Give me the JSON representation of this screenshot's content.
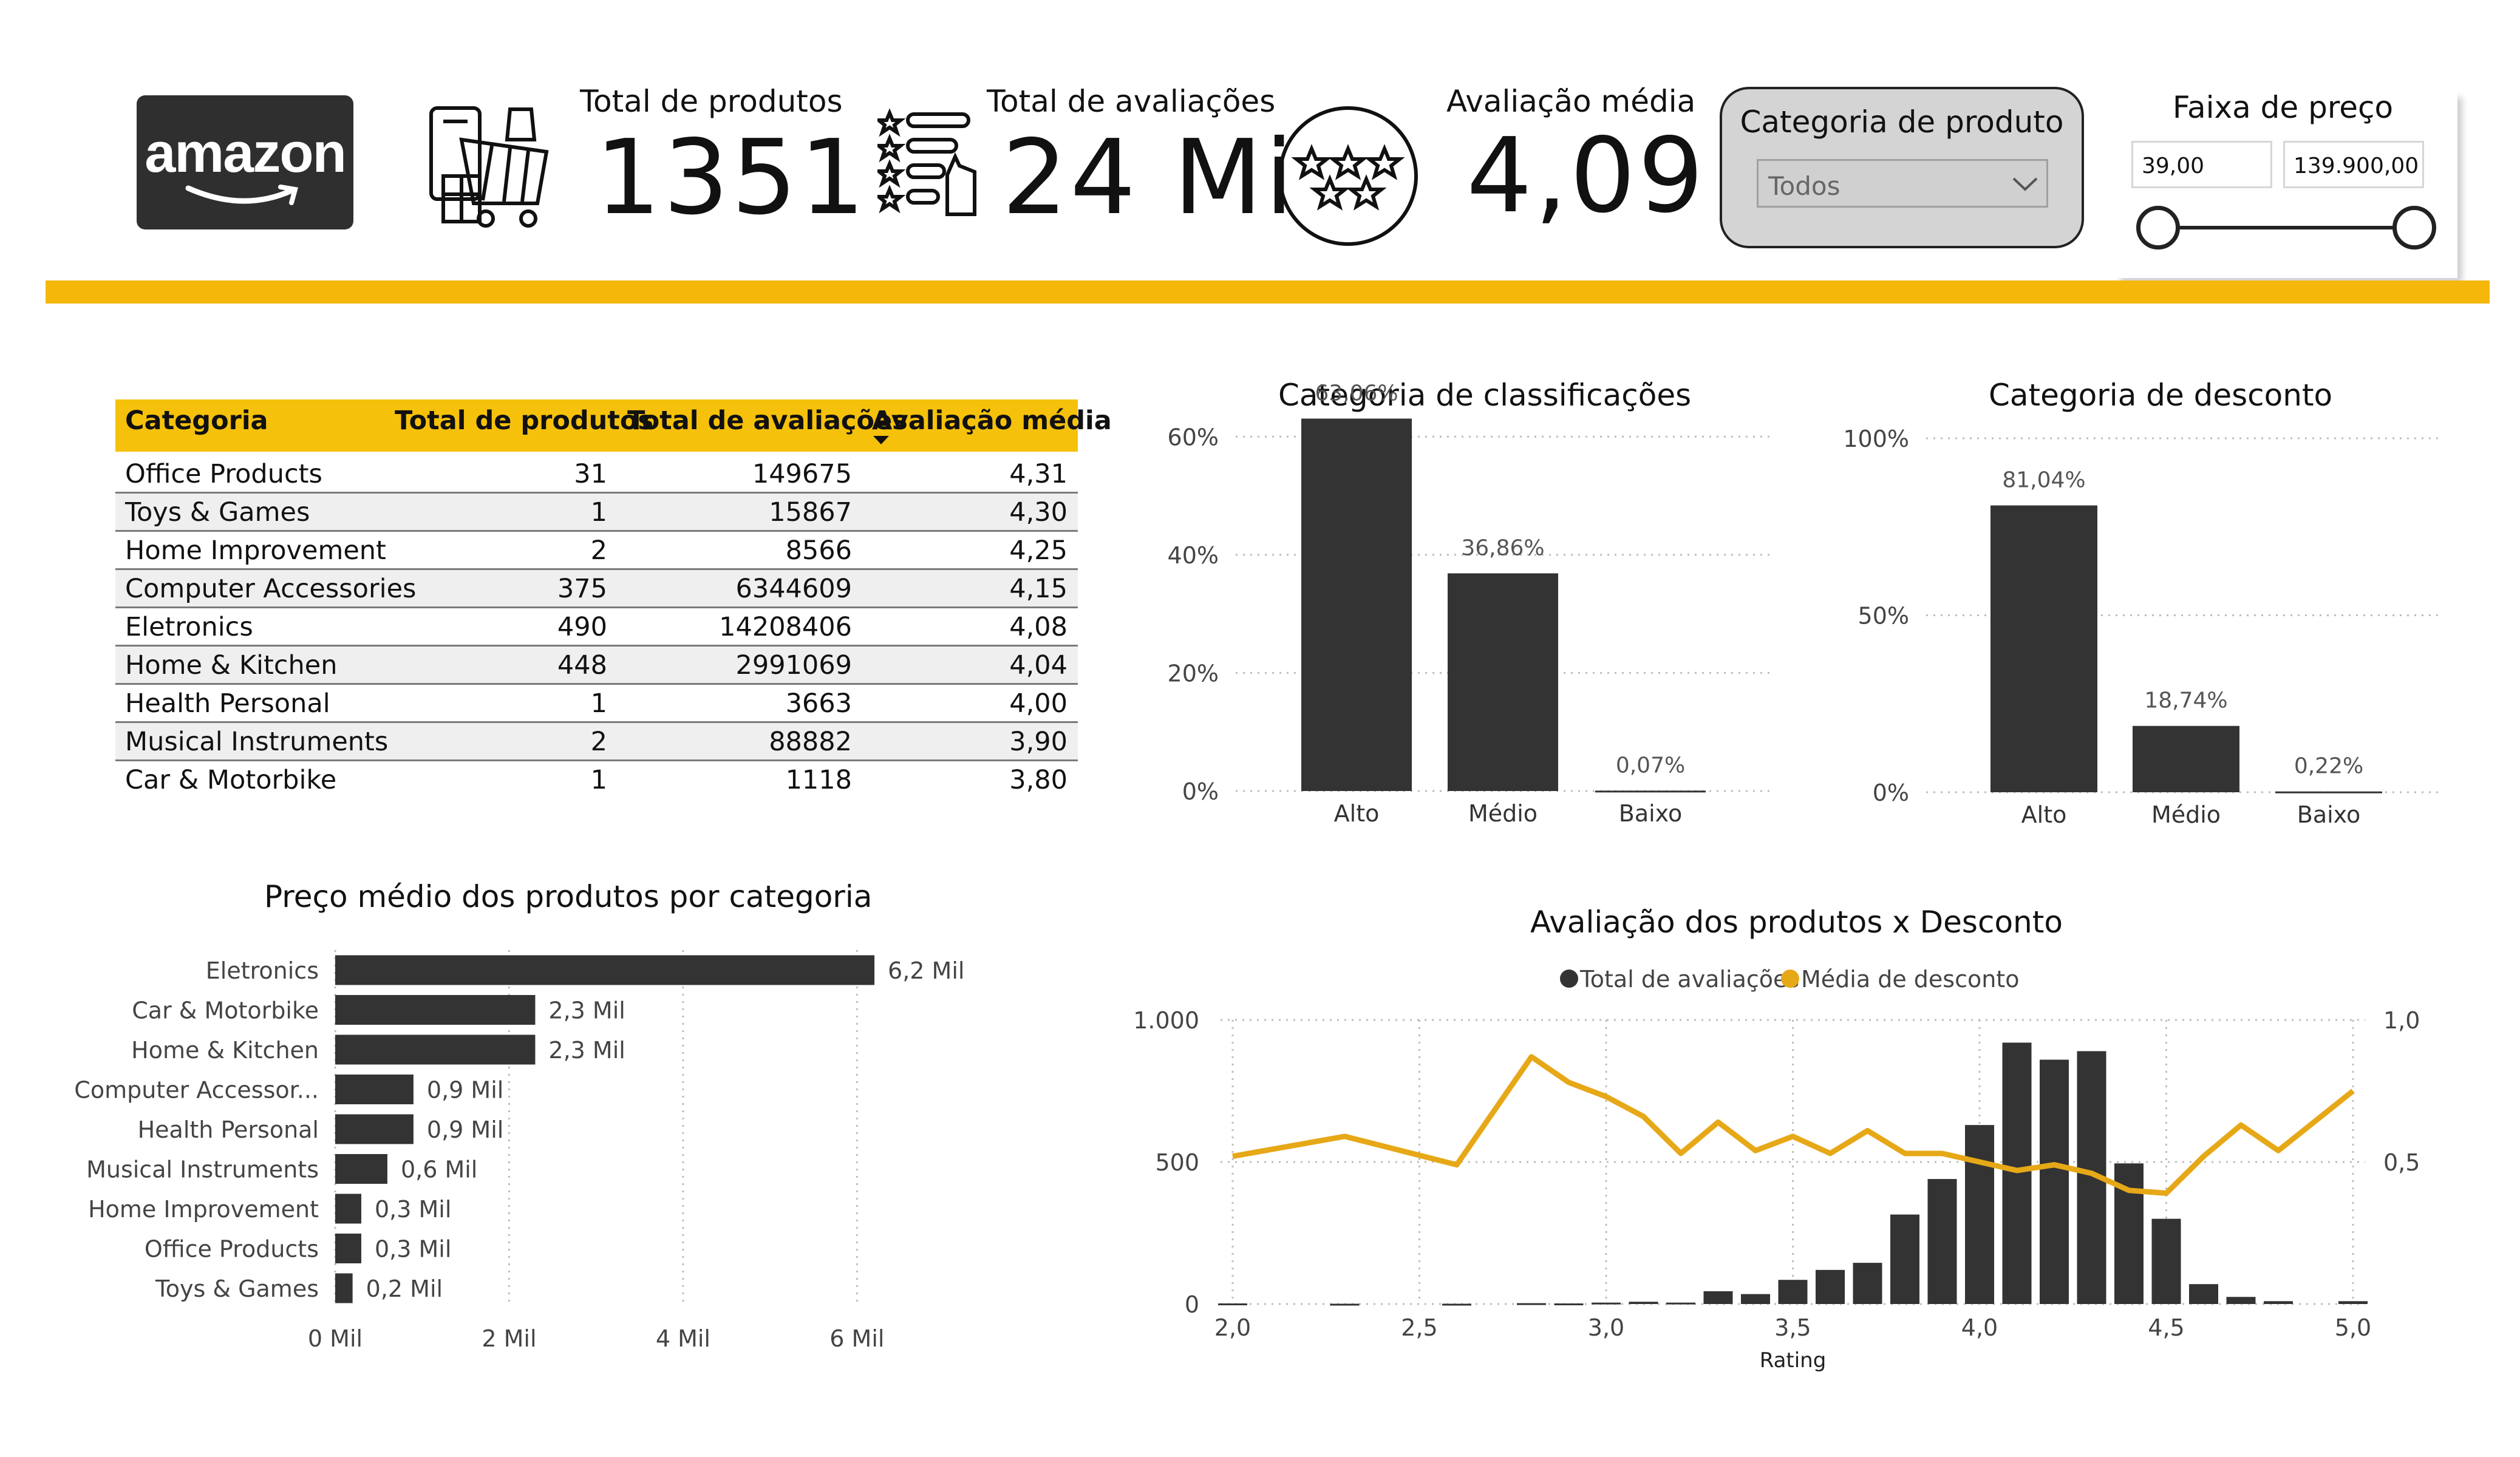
{
  "header": {
    "logo_text": "amazon",
    "kpis": [
      {
        "label": "Total de produtos",
        "value": "1351"
      },
      {
        "label": "Total de avaliações",
        "value": "24 Mi"
      },
      {
        "label": "Avaliação média",
        "value": "4,09"
      }
    ],
    "category_filter": {
      "title": "Categoria de produto",
      "selected": "Todos"
    },
    "price_filter": {
      "title": "Faixa de preço",
      "min": "39,00",
      "max": "139.900,00"
    }
  },
  "colors": {
    "accent": "#f5b70a",
    "bar": "#333333",
    "line": "#e6a817"
  },
  "table": {
    "columns": [
      "Categoria",
      "Total de produtos",
      "Total de avaliações",
      "Avaliação média"
    ],
    "sort_column": "Avaliação média",
    "rows": [
      [
        "Office Products",
        "31",
        "149675",
        "4,31"
      ],
      [
        "Toys & Games",
        "1",
        "15867",
        "4,30"
      ],
      [
        "Home Improvement",
        "2",
        "8566",
        "4,25"
      ],
      [
        "Computer Accessories",
        "375",
        "6344609",
        "4,15"
      ],
      [
        "Eletronics",
        "490",
        "14208406",
        "4,08"
      ],
      [
        "Home & Kitchen",
        "448",
        "2991069",
        "4,04"
      ],
      [
        "Health Personal",
        "1",
        "3663",
        "4,00"
      ],
      [
        "Musical Instruments",
        "2",
        "88882",
        "3,90"
      ],
      [
        "Car & Motorbike",
        "1",
        "1118",
        "3,80"
      ]
    ]
  },
  "chart_data": [
    {
      "type": "bar",
      "title": "Categoria de classificações",
      "categories": [
        "Alto",
        "Médio",
        "Baixo"
      ],
      "values": [
        63.06,
        36.86,
        0.07
      ],
      "data_labels": [
        "63,06%",
        "36,86%",
        "0,07%"
      ],
      "ylim": [
        0,
        70
      ],
      "yticks": [
        0,
        20,
        40,
        60
      ],
      "ytick_labels": [
        "0%",
        "20%",
        "40%",
        "60%"
      ],
      "grid": true
    },
    {
      "type": "bar",
      "title": "Categoria de desconto",
      "categories": [
        "Alto",
        "Médio",
        "Baixo"
      ],
      "values": [
        81.04,
        18.74,
        0.22
      ],
      "data_labels": [
        "81,04%",
        "18,74%",
        "0,22%"
      ],
      "ylim": [
        0,
        100
      ],
      "yticks": [
        0,
        50,
        100
      ],
      "ytick_labels": [
        "0%",
        "50%",
        "100%"
      ],
      "grid": true
    },
    {
      "type": "bar",
      "orientation": "horizontal",
      "title": "Preço médio dos produtos por categoria",
      "categories": [
        "Eletronics",
        "Car & Motorbike",
        "Home & Kitchen",
        "Computer Accessor...",
        "Health Personal",
        "Musical Instruments",
        "Home Improvement",
        "Office Products",
        "Toys & Games"
      ],
      "values": [
        6.2,
        2.3,
        2.3,
        0.9,
        0.9,
        0.6,
        0.3,
        0.3,
        0.2
      ],
      "data_labels": [
        "6,2 Mil",
        "2,3 Mil",
        "2,3 Mil",
        "0,9 Mil",
        "0,9 Mil",
        "0,6 Mil",
        "0,3 Mil",
        "0,3 Mil",
        "0,2 Mil"
      ],
      "xlim": [
        0,
        6.5
      ],
      "xticks": [
        0,
        2,
        4,
        6
      ],
      "xtick_labels": [
        "0 Mil",
        "2 Mil",
        "4 Mil",
        "6 Mil"
      ],
      "grid": true
    },
    {
      "type": "bar+line",
      "title": "Avaliação dos produtos x Desconto",
      "xlabel": "Rating",
      "xlim": [
        2.0,
        5.0
      ],
      "xticks": [
        2.0,
        2.5,
        3.0,
        3.5,
        4.0,
        4.5,
        5.0
      ],
      "xtick_labels": [
        "2,0",
        "2,5",
        "3,0",
        "3,5",
        "4,0",
        "4,5",
        "5,0"
      ],
      "y_left": {
        "ylim": [
          0,
          1000
        ],
        "ticks": [
          0,
          500,
          1000
        ],
        "tick_labels": [
          "0",
          "500",
          "1.000"
        ]
      },
      "y_right": {
        "ylim": [
          0,
          1.0
        ],
        "ticks": [
          0.5,
          1.0
        ],
        "tick_labels": [
          "0,5",
          "1,0"
        ]
      },
      "legend": "top-center",
      "grid": true,
      "series": [
        {
          "name": "Total de avaliações",
          "kind": "bar",
          "color": "#333333",
          "x": [
            2.0,
            2.3,
            2.6,
            2.8,
            2.9,
            3.0,
            3.1,
            3.2,
            3.3,
            3.4,
            3.5,
            3.6,
            3.7,
            3.8,
            3.9,
            4.0,
            4.1,
            4.2,
            4.3,
            4.4,
            4.5,
            4.6,
            4.7,
            4.8,
            5.0
          ],
          "values": [
            2,
            1,
            1,
            3,
            2,
            5,
            8,
            5,
            45,
            35,
            85,
            120,
            145,
            315,
            440,
            630,
            920,
            860,
            890,
            495,
            300,
            70,
            25,
            10,
            10
          ]
        },
        {
          "name": "Média de desconto",
          "kind": "line",
          "color": "#e6a817",
          "x": [
            2.0,
            2.3,
            2.6,
            2.8,
            2.9,
            3.0,
            3.1,
            3.2,
            3.3,
            3.4,
            3.5,
            3.6,
            3.7,
            3.8,
            3.9,
            4.0,
            4.1,
            4.2,
            4.3,
            4.4,
            4.5,
            4.6,
            4.7,
            4.8,
            5.0
          ],
          "values": [
            0.52,
            0.59,
            0.49,
            0.87,
            0.78,
            0.73,
            0.66,
            0.53,
            0.64,
            0.54,
            0.59,
            0.53,
            0.61,
            0.53,
            0.53,
            0.5,
            0.47,
            0.49,
            0.46,
            0.4,
            0.39,
            0.52,
            0.63,
            0.54,
            0.75
          ]
        }
      ]
    }
  ]
}
